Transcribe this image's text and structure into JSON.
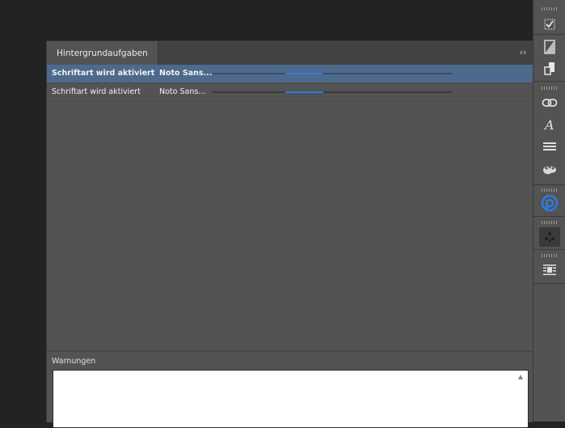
{
  "panel": {
    "tab_title": "Hintergrundaufgaben",
    "collapse_symbol": "››",
    "tasks": [
      {
        "name": "Schriftart wird aktiviert",
        "font": "Noto Sans...",
        "progress": 0.3,
        "selected": true
      },
      {
        "name": "Schriftart wird aktiviert",
        "font": "Noto Sans...",
        "progress": 0.3,
        "selected": false
      }
    ],
    "warnings_label": "Warnungen",
    "warnings_scroll_symbol": "▲"
  },
  "dock": {
    "icons": [
      "preflight-icon",
      "swatch-icon",
      "pages-icon",
      "links-icon",
      "character-styles-icon",
      "paragraph-styles-icon",
      "color-theme-icon",
      "cc-libraries-icon",
      "scatter-icon",
      "text-wrap-icon"
    ]
  },
  "colors": {
    "accent": "#2d7be0",
    "selection": "#4d6a8c",
    "panel_bg": "#535353",
    "app_bg": "#232323"
  }
}
